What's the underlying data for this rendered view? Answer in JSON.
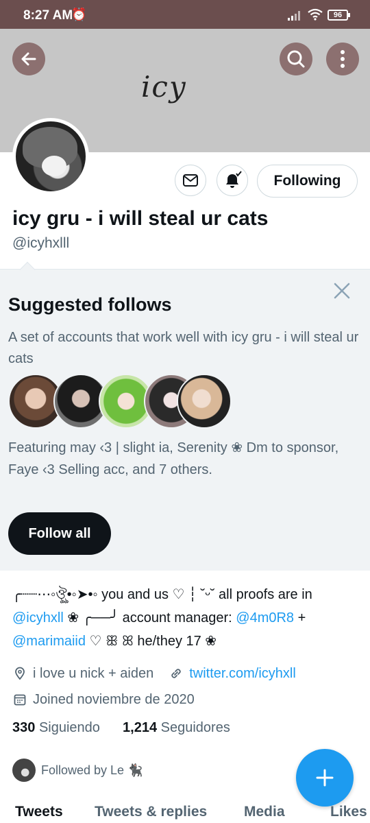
{
  "status_bar": {
    "time": "8:27 AM",
    "battery": "96"
  },
  "banner": {
    "signature_text": "icy"
  },
  "profile": {
    "display_name": "icy gru - i will steal ur cats",
    "handle": "@icyhxlll",
    "following_button": "Following"
  },
  "suggested": {
    "title": "Suggested follows",
    "description": "A set of accounts that work well with icy gru - i will steal ur cats",
    "featuring": "Featuring may ‹3 | slight ia, Serenity ❀ Dm to sponsor, Faye ‹3 Selling acc, and 7 others.",
    "follow_all": "Follow all"
  },
  "bio": {
    "part1": "╭┈┈⋯◦ঔৣ•◦➤•◦ you and us ♡ ┆ ˘ᵕ˘ all proofs are in ",
    "link1": "@icyhxll",
    "part2": " ❀ ╭──╯ account manager: ",
    "link2": "@4m0R8",
    "part3": " + ",
    "link3": "@marimaiid",
    "part4": " ♡ ꕥ ꕤ he/they 17 ❀"
  },
  "meta": {
    "location": "i love u nick + aiden",
    "website": "twitter.com/icyhxll",
    "joined": "Joined noviembre de 2020"
  },
  "counts": {
    "following_count": "330",
    "following_label": "Siguiendo",
    "followers_count": "1,214",
    "followers_label": "Seguidores"
  },
  "followed_by": "Followed by Le 🐈‍⬛",
  "tabs": [
    "Tweets",
    "Tweets & replies",
    "Media",
    "Likes"
  ],
  "colors": {
    "accent": "#1d9bf0",
    "status_bar": "#6b4e4e",
    "banner": "#c6c6c6"
  }
}
